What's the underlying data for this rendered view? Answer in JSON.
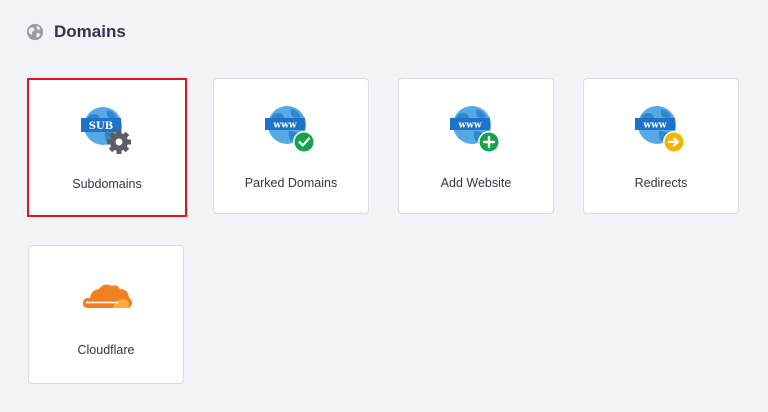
{
  "section": {
    "title": "Domains",
    "icon": "globe-icon"
  },
  "cards": [
    {
      "label": "Subdomains",
      "icon": "subdomain-globe-icon",
      "badge": "gear-icon",
      "selected": true
    },
    {
      "label": "Parked Domains",
      "icon": "www-globe-icon",
      "badge": "check-badge-icon"
    },
    {
      "label": "Add Website",
      "icon": "www-globe-icon",
      "badge": "plus-badge-icon"
    },
    {
      "label": "Redirects",
      "icon": "www-globe-icon",
      "badge": "arrow-badge-icon"
    },
    {
      "label": "Cloudflare",
      "icon": "cloudflare-icon"
    }
  ],
  "globe_labels": {
    "sub": "SUB",
    "www": "www"
  },
  "colors": {
    "globe": "#54a9e6",
    "banner": "#1e72c7",
    "gear": "#5c5e63",
    "check": "#16a34a",
    "plus": "#16a34a",
    "arrow": "#f5b400",
    "cloudflare": "#f38020",
    "selected_border": "#e3141b"
  }
}
